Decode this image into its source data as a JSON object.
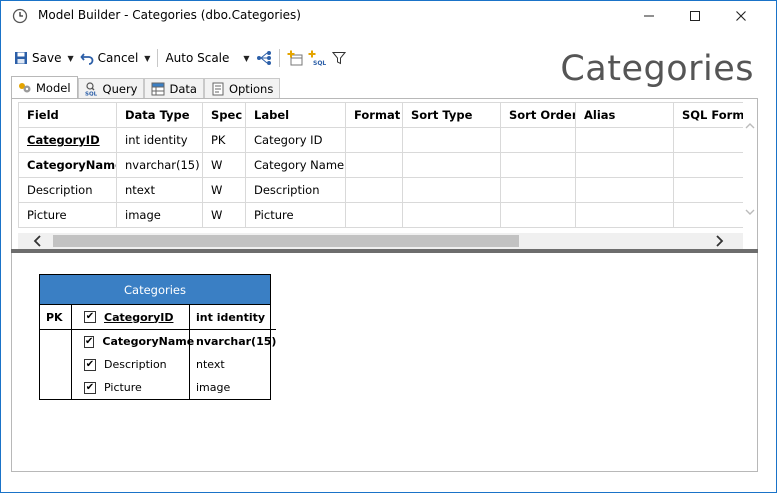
{
  "window": {
    "title": "Model Builder - Categories (dbo.Categories)"
  },
  "toolbar": {
    "save_label": "Save",
    "cancel_label": "Cancel",
    "scale_label": "Auto Scale"
  },
  "page_title": "Categories",
  "tabs": [
    {
      "label": "Model",
      "icon": "model-icon",
      "active": true
    },
    {
      "label": "Query",
      "icon": "sql-icon",
      "active": false
    },
    {
      "label": "Data",
      "icon": "data-grid-icon",
      "active": false
    },
    {
      "label": "Options",
      "icon": "options-icon",
      "active": false
    }
  ],
  "grid": {
    "columns": [
      "Field",
      "Data Type",
      "Spec",
      "Label",
      "Format",
      "Sort Type",
      "Sort Order",
      "Alias",
      "SQL Formu"
    ],
    "rows": [
      {
        "field": "CategoryID",
        "type": "int identity",
        "spec": "PK",
        "label": "Category ID"
      },
      {
        "field": "CategoryName",
        "type": "nvarchar(15)",
        "spec": "W",
        "label": "Category Name"
      },
      {
        "field": "Description",
        "type": "ntext",
        "spec": "W",
        "label": "Description"
      },
      {
        "field": "Picture",
        "type": "image",
        "spec": "W",
        "label": "Picture"
      }
    ]
  },
  "entity": {
    "name": "Categories",
    "pk_label": "PK",
    "fields": [
      {
        "name": "CategoryID",
        "type": "int identity",
        "checked": true
      },
      {
        "name": "CategoryName",
        "type": "nvarchar(15)",
        "checked": true
      },
      {
        "name": "Description",
        "type": "ntext",
        "checked": true
      },
      {
        "name": "Picture",
        "type": "image",
        "checked": true
      }
    ]
  },
  "colors": {
    "accent": "#1a73c8",
    "entity_header": "#3a7fc4"
  }
}
